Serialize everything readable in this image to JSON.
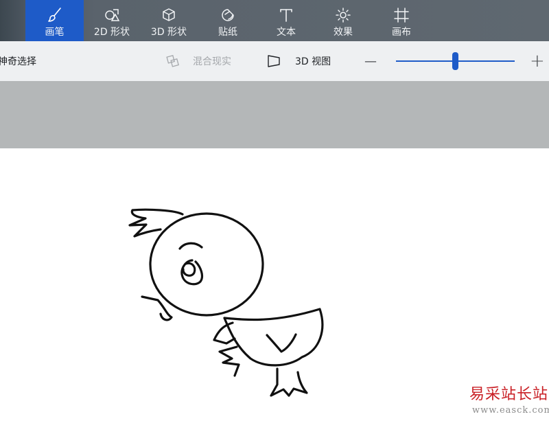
{
  "tabs": [
    {
      "label": "画笔",
      "icon": "brush-icon",
      "active": true
    },
    {
      "label": "2D 形状",
      "icon": "shapes-2d-icon",
      "active": false
    },
    {
      "label": "3D 形状",
      "icon": "cube-3d-icon",
      "active": false
    },
    {
      "label": "贴纸",
      "icon": "sticker-icon",
      "active": false
    },
    {
      "label": "文本",
      "icon": "text-icon",
      "active": false
    },
    {
      "label": "效果",
      "icon": "effects-sun-icon",
      "active": false
    },
    {
      "label": "画布",
      "icon": "canvas-crop-icon",
      "active": false
    }
  ],
  "toolbar": {
    "magic_select_label": "神奇选择",
    "mixed_reality_label": "混合现实",
    "view_3d_label": "3D 视图",
    "zoom_out_symbol": "—",
    "zoom_in_symbol": "+",
    "zoom_level": 0.5
  },
  "colors": {
    "accent": "#1e5bc8",
    "topbar": "#5f6870",
    "toolbar": "#eef0f2",
    "gray_band": "#b4b7b8",
    "canvas": "#ffffff"
  },
  "watermark": {
    "title": "易采站长站",
    "url": "www.easck.com"
  }
}
